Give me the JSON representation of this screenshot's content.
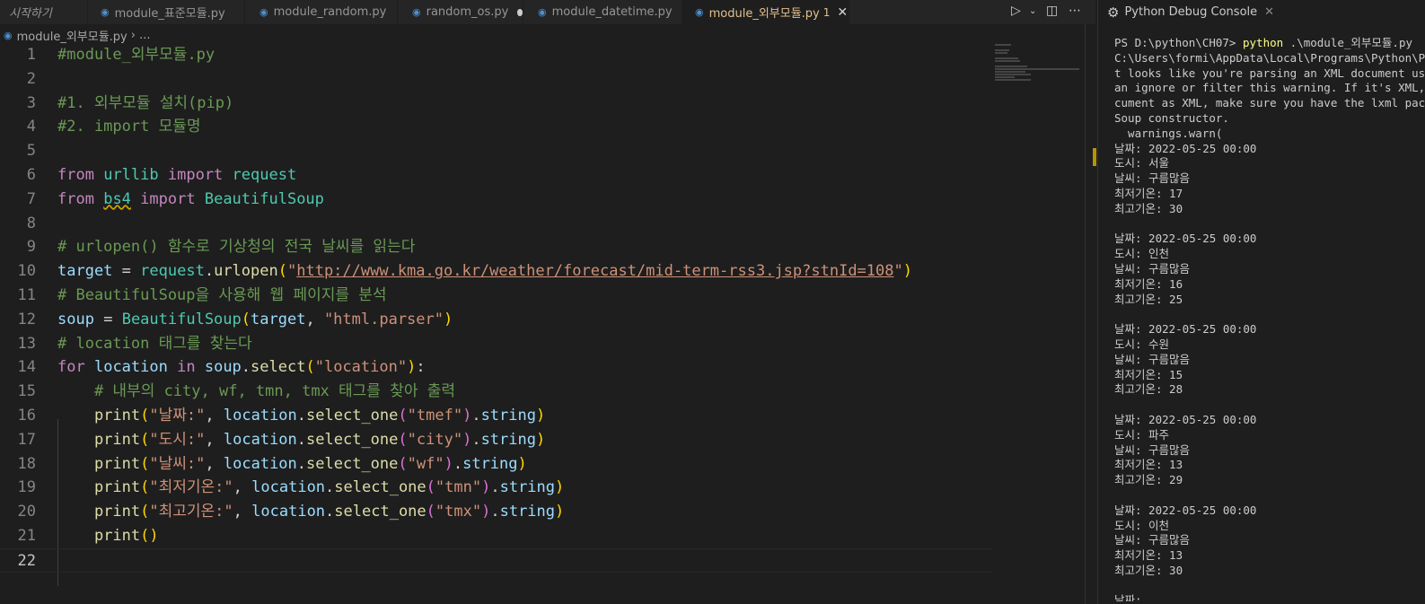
{
  "tabs": [
    {
      "label": "시작하기",
      "state": "preview"
    },
    {
      "label": "module_표준모듈.py",
      "state": "normal"
    },
    {
      "label": "module_random.py",
      "state": "normal"
    },
    {
      "label": "random_os.py",
      "state": "dirty"
    },
    {
      "label": "module_datetime.py",
      "state": "normal"
    },
    {
      "label": "module_외부모듈.py",
      "state": "active",
      "problems": "1"
    }
  ],
  "breadcrumb": {
    "file": "module_외부모듈.py",
    "rest": "› ..."
  },
  "editor": {
    "current_line": 22,
    "lines": [
      {
        "n": "1",
        "text": "#module_외부모듈.py"
      },
      {
        "n": "2",
        "text": ""
      },
      {
        "n": "3",
        "text": "#1. 외부모듈 설치(pip)"
      },
      {
        "n": "4",
        "text": "#2. import 모듈명"
      },
      {
        "n": "5",
        "text": ""
      },
      {
        "n": "6",
        "text": "from urllib import request"
      },
      {
        "n": "7",
        "text": "from bs4 import BeautifulSoup"
      },
      {
        "n": "8",
        "text": ""
      },
      {
        "n": "9",
        "text": "# urlopen() 함수로 기상청의 전국 날씨를 읽는다"
      },
      {
        "n": "10",
        "text": "target = request.urlopen(\"http://www.kma.go.kr/weather/forecast/mid-term-rss3.jsp?stnId=108\")"
      },
      {
        "n": "11",
        "text": "# BeautifulSoup을 사용해 웹 페이지를 분석"
      },
      {
        "n": "12",
        "text": "soup = BeautifulSoup(target, \"html.parser\")"
      },
      {
        "n": "13",
        "text": "# location 태그를 찾는다"
      },
      {
        "n": "14",
        "text": "for location in soup.select(\"location\"):"
      },
      {
        "n": "15",
        "text": "    # 내부의 city, wf, tmn, tmx 태그를 찾아 출력"
      },
      {
        "n": "16",
        "text": "    print(\"날짜:\", location.select_one(\"tmef\").string)"
      },
      {
        "n": "17",
        "text": "    print(\"도시:\", location.select_one(\"city\").string)"
      },
      {
        "n": "18",
        "text": "    print(\"날씨:\", location.select_one(\"wf\").string)"
      },
      {
        "n": "19",
        "text": "    print(\"최저기온:\", location.select_one(\"tmn\").string)"
      },
      {
        "n": "20",
        "text": "    print(\"최고기온:\", location.select_one(\"tmx\").string)"
      },
      {
        "n": "21",
        "text": "    print()"
      },
      {
        "n": "22",
        "text": ""
      }
    ]
  },
  "panel": {
    "title": "Python Debug Console",
    "terminal_lines": [
      {
        "text": "PS D:\\python\\CH07> ",
        "cmd": "python",
        "rest": " .\\module_외부모듈.py"
      },
      {
        "text": "C:\\Users\\formi\\AppData\\Local\\Programs\\Python\\Pyt"
      },
      {
        "text": "t looks like you're parsing an XML document usin"
      },
      {
        "text": "an ignore or filter this warning. If it's XML, y"
      },
      {
        "text": "cument as XML, make sure you have the lxml packa"
      },
      {
        "text": "Soup constructor."
      },
      {
        "text": "  warnings.warn("
      },
      {
        "text": "날짜: 2022-05-25 00:00"
      },
      {
        "text": "도시: 서울"
      },
      {
        "text": "날씨: 구름많음"
      },
      {
        "text": "최저기온: 17"
      },
      {
        "text": "최고기온: 30"
      },
      {
        "text": ""
      },
      {
        "text": "날짜: 2022-05-25 00:00"
      },
      {
        "text": "도시: 인천"
      },
      {
        "text": "날씨: 구름많음"
      },
      {
        "text": "최저기온: 16"
      },
      {
        "text": "최고기온: 25"
      },
      {
        "text": ""
      },
      {
        "text": "날짜: 2022-05-25 00:00"
      },
      {
        "text": "도시: 수원"
      },
      {
        "text": "날씨: 구름많음"
      },
      {
        "text": "최저기온: 15"
      },
      {
        "text": "최고기온: 28"
      },
      {
        "text": ""
      },
      {
        "text": "날짜: 2022-05-25 00:00"
      },
      {
        "text": "도시: 파주"
      },
      {
        "text": "날씨: 구름많음"
      },
      {
        "text": "최저기온: 13"
      },
      {
        "text": "최고기온: 29"
      },
      {
        "text": ""
      },
      {
        "text": "날짜: 2022-05-25 00:00"
      },
      {
        "text": "도시: 이천"
      },
      {
        "text": "날씨: 구름많음"
      },
      {
        "text": "최저기온: 13"
      },
      {
        "text": "최고기온: 30"
      },
      {
        "text": ""
      },
      {
        "text": "날짜:"
      }
    ]
  },
  "icons": {
    "python_file": "python-file-icon",
    "run": "play-icon",
    "split": "split-editor-icon",
    "more": "more-actions-icon",
    "debug": "debug-icon",
    "close": "close-icon"
  },
  "colors": {
    "accent_tab": "#e2c08d",
    "comment": "#6a9955",
    "keyword": "#c586c0",
    "string": "#ce9178"
  }
}
